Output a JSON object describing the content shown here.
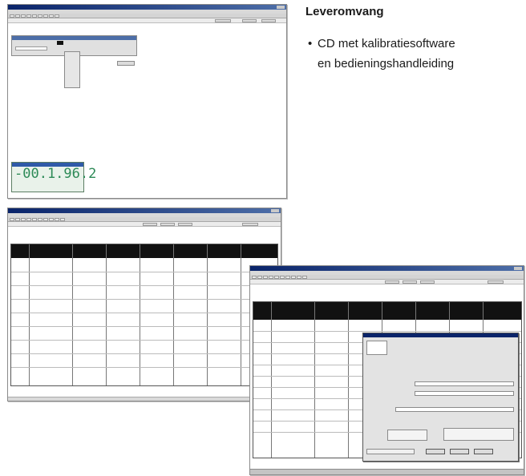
{
  "side_text": {
    "heading": "Leveromvang",
    "items": [
      {
        "bullet": "•",
        "line1": "CD met kalibratiesoftware",
        "line2": "en bedieningshandleiding"
      }
    ]
  },
  "screenshots": [
    {
      "name": "single-reading-window",
      "display_value": "-00.1.96.2"
    },
    {
      "name": "table-window"
    },
    {
      "name": "dialog-window"
    }
  ],
  "colors": {
    "titlebar": "#0a246a",
    "lcd_background": "#e9f2ea",
    "lcd_digits": "#2d8a57",
    "table_header": "#111111",
    "window_chrome": "#d4d4d4"
  }
}
